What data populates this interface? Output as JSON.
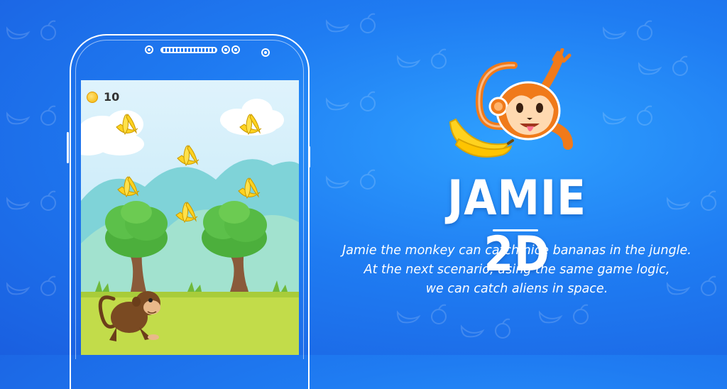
{
  "game": {
    "score": "10",
    "coin_icon": "coin-icon",
    "character": "monkey",
    "collectible": "banana"
  },
  "title": "JAMIE 2D",
  "description": {
    "line1": "Jamie the monkey can catch nice bananas in the jungle.",
    "line2": "At the next scenario, using the same game logic,",
    "line3": "we can catch aliens in space."
  },
  "colors": {
    "background": "#1f7cf2",
    "text": "#ffffff",
    "monkey": "#f07a1a",
    "banana": "#ffd21f"
  }
}
